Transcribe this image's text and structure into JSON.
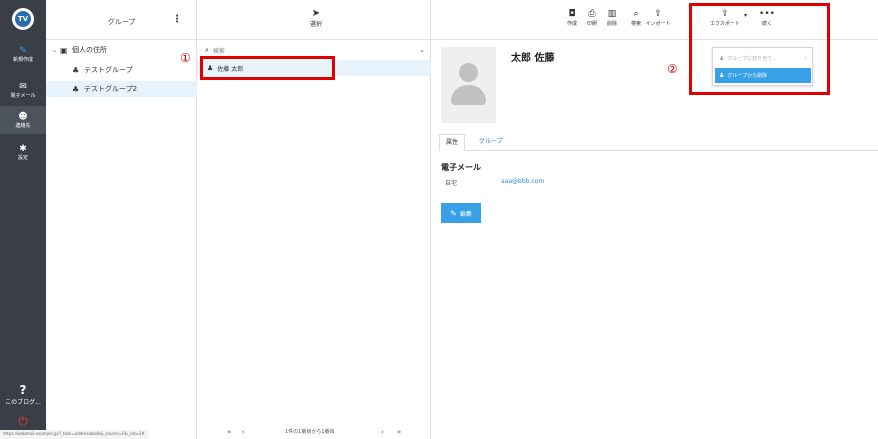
{
  "nav": {
    "logo_text": "TV",
    "items": [
      {
        "icon": "new-icon",
        "glyph": "✎",
        "label": "新規作成"
      },
      {
        "icon": "mail-icon",
        "glyph": "✉",
        "label": "電子メール"
      },
      {
        "icon": "contacts-icon",
        "glyph": "☻",
        "label": "連絡先"
      },
      {
        "icon": "settings-icon",
        "glyph": "✱",
        "label": "設定"
      }
    ],
    "help_glyph": "?",
    "help_label": "このブログ...",
    "power_glyph": "⏻"
  },
  "folders": {
    "title": "グループ",
    "menu_glyph": "⋮",
    "items": [
      {
        "chev": "⌄",
        "icon_glyph": "▣",
        "label": "個人の住所"
      },
      {
        "chev": "",
        "icon_glyph": "♣",
        "label": "テストグループ"
      },
      {
        "chev": "",
        "icon_glyph": "♣",
        "label": "テストグループ2"
      }
    ]
  },
  "list": {
    "select_glyph": "➤",
    "select_label": "選択",
    "search_placeholder": "検索",
    "search_glyph": "⌕",
    "chev_glyph": "⌄",
    "contact_glyph": "♟",
    "contact": "佐藤 太郎",
    "pager_first": "«",
    "pager_prev": "‹",
    "pager_text": "1件の1番目から1番目",
    "pager_next": "›",
    "pager_last": "»"
  },
  "toolbar": {
    "tools": [
      {
        "glyph": "◘",
        "label": "作成"
      },
      {
        "glyph": "⎙",
        "label": "印刷"
      },
      {
        "glyph": "▥",
        "label": "削除"
      },
      {
        "glyph": "⌕",
        "label": "検索"
      },
      {
        "glyph": "⇪",
        "label": "インポート"
      },
      {
        "glyph": "⇪",
        "label": "エクスポート"
      },
      {
        "glyph": "•••",
        "label": "続く"
      }
    ],
    "caret": "▾"
  },
  "detail": {
    "name": "太郎 佐藤",
    "tab_properties": "属性",
    "tab_groups": "グループ",
    "section_email": "電子メール",
    "email_label": "自宅",
    "email_value": "aaa@bbb.com",
    "edit_label": "編集",
    "edit_glyph": "✎"
  },
  "dropdown": {
    "assign_label": "グループに割り当て...",
    "assign_glyph": "♟",
    "assign_arrow": "›",
    "remove_label": "グループから削除",
    "remove_glyph": "♟"
  },
  "annotations": {
    "one": "①",
    "two": "②"
  },
  "status_url": "https://webmail.example.jp/?_task=addressbook&_source=0&_cid=1#"
}
